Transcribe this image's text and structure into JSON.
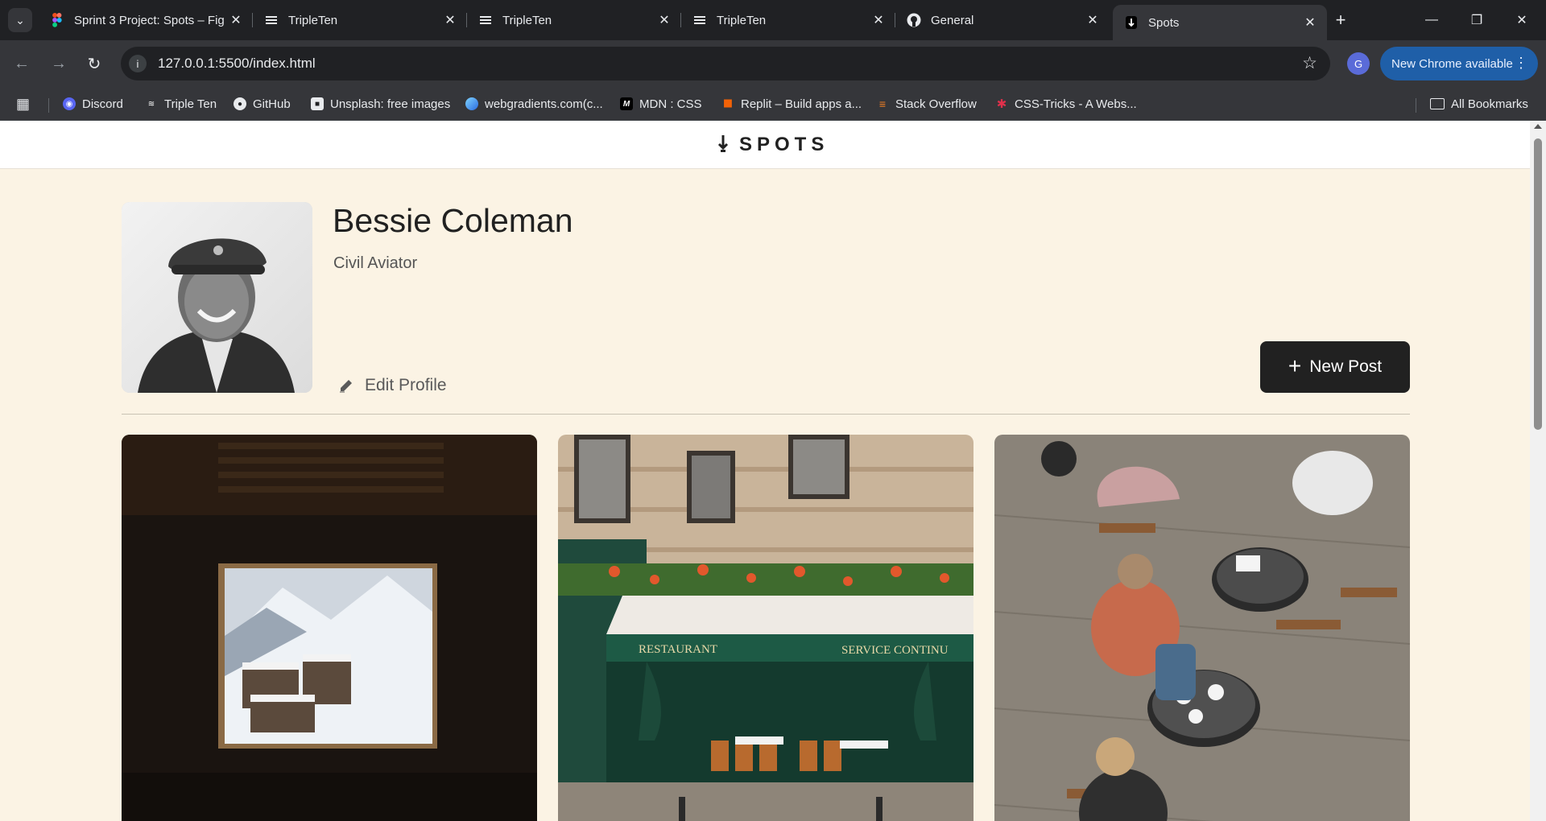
{
  "browser": {
    "tabs": [
      {
        "title": "Sprint 3 Project: Spots – Fig",
        "icon": "figma-icon",
        "active": false
      },
      {
        "title": "TripleTen",
        "icon": "tripleten-icon",
        "active": false
      },
      {
        "title": "TripleTen",
        "icon": "tripleten-icon",
        "active": false
      },
      {
        "title": "TripleTen",
        "icon": "tripleten-icon",
        "active": false
      },
      {
        "title": "General",
        "icon": "github-icon",
        "active": false
      },
      {
        "title": "Spots",
        "icon": "spots-icon",
        "active": true
      }
    ],
    "address": "127.0.0.1:5500/index.html",
    "update_button": "New Chrome available",
    "profile_initial": "G",
    "bookmarks": [
      {
        "label": "Discord",
        "icon": "discord-icon",
        "color": "#5865f2"
      },
      {
        "label": "Triple Ten",
        "icon": "tripleten-icon",
        "color": "#3c4043"
      },
      {
        "label": "GitHub",
        "icon": "github-icon",
        "color": "#3c4043"
      },
      {
        "label": "Unsplash: free images",
        "icon": "unsplash-icon",
        "color": "#3c4043"
      },
      {
        "label": "webgradients.com(c...",
        "icon": "webgradients-icon",
        "color": "#4aa3ff"
      },
      {
        "label": "MDN : CSS",
        "icon": "mdn-icon",
        "color": "#000000"
      },
      {
        "label": "Replit – Build apps a...",
        "icon": "replit-icon",
        "color": "#f26207"
      },
      {
        "label": "Stack Overflow",
        "icon": "stackoverflow-icon",
        "color": "#f48024"
      },
      {
        "label": "CSS-Tricks - A Webs...",
        "icon": "csstricks-icon",
        "color": "#e0304b"
      }
    ],
    "all_bookmarks": "All Bookmarks"
  },
  "site": {
    "logo_text": "SPOTS",
    "profile": {
      "name": "Bessie Coleman",
      "description": "Civil Aviator",
      "edit_label": "Edit Profile",
      "new_post_label": "New Post"
    },
    "cards": [
      {
        "image": "snowy-mountain-village-through-window"
      },
      {
        "image": "paris-restaurant-storefront"
      },
      {
        "image": "outdoor-cafe-terrace"
      }
    ]
  },
  "colors": {
    "page_background": "#fbf3e4",
    "button_dark": "#212121",
    "text_primary": "#212121"
  }
}
